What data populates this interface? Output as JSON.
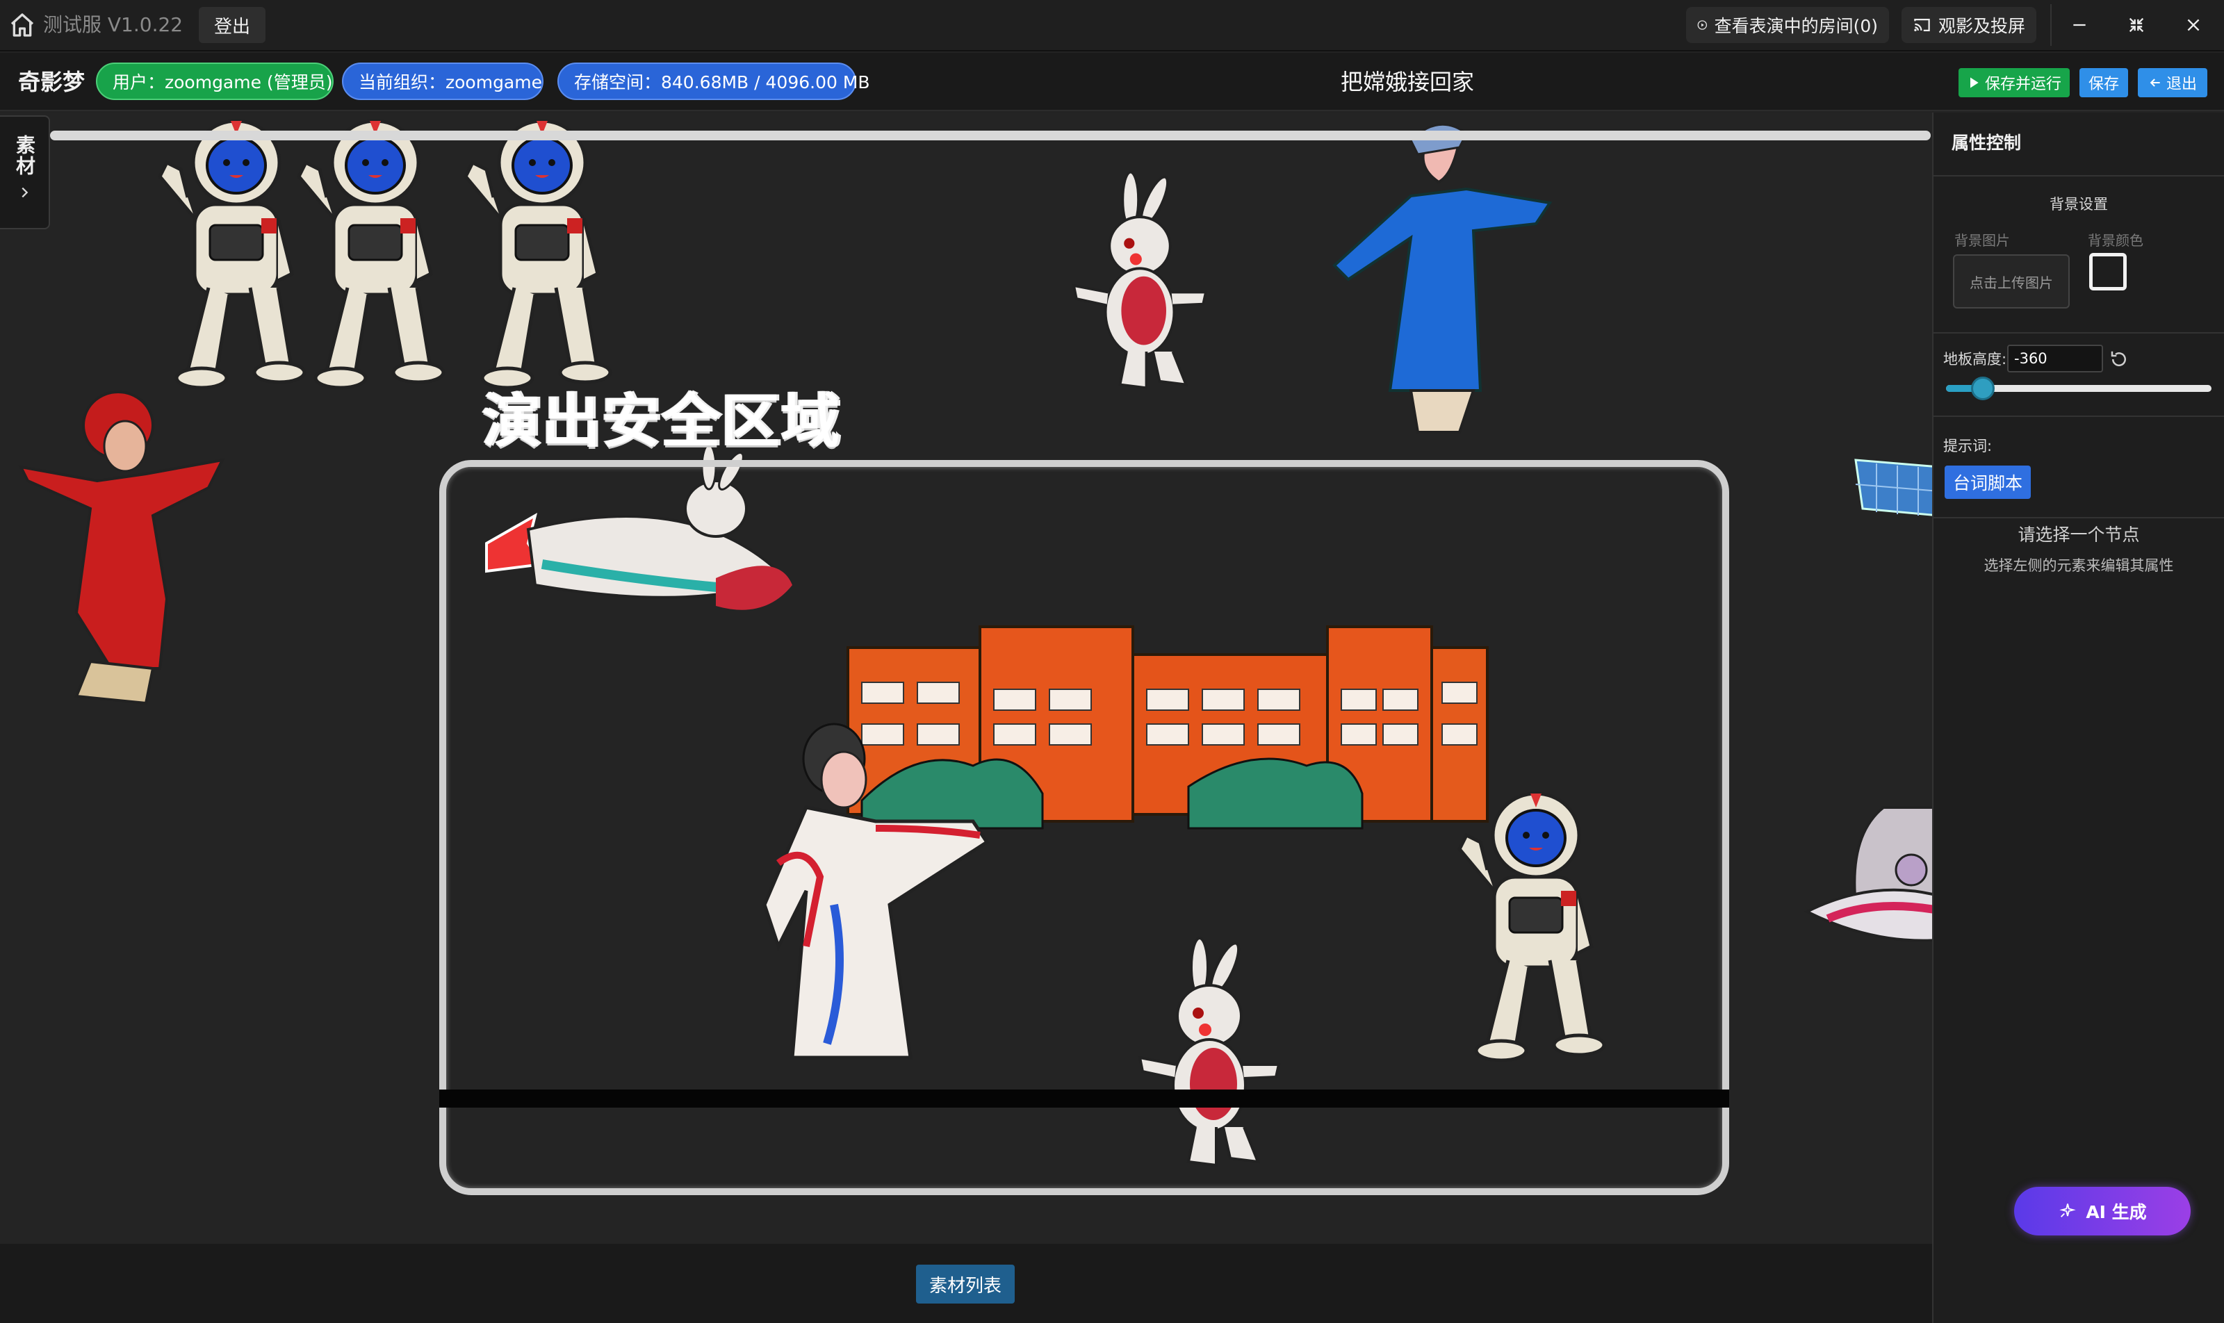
{
  "titlebar": {
    "app_title": "测试服 V1.0.22",
    "logout_label": "登出",
    "rooms_label": "查看表演中的房间(0)",
    "cast_label": "观影及投屏"
  },
  "infobar": {
    "brand": "奇影梦",
    "user_badge": "用户：zoomgame (管理员)",
    "org_badge": "当前组织：zoomgame",
    "storage_badge": "存储空间：840.68MB / 4096.00 MB",
    "stage_title": "把嫦娥接回家",
    "save_run_label": "保存并运行",
    "save_label": "保存",
    "exit_label": "退出"
  },
  "stage": {
    "material_tab_label": "素材",
    "safe_area_label": "演出安全区域",
    "material_list_label": "素材列表"
  },
  "panel": {
    "title": "属性控制",
    "bg_settings_title": "背景设置",
    "bg_image_label": "背景图片",
    "bg_color_label": "背景颜色",
    "upload_label": "点击上传图片",
    "floor_height_label": "地板高度:",
    "floor_height_value": "-360",
    "prompt_label": "提示词:",
    "script_button_label": "台词脚本",
    "empty_title": "请选择一个节点",
    "empty_subtitle": "选择左侧的元素来编辑其属性",
    "ai_button_label": "AI 生成"
  },
  "colors": {
    "accent_green": "#17a54a",
    "accent_blue": "#2f8fe8",
    "ai_gradient_start": "#5a3ae8",
    "ai_gradient_end": "#9b3fe6"
  }
}
